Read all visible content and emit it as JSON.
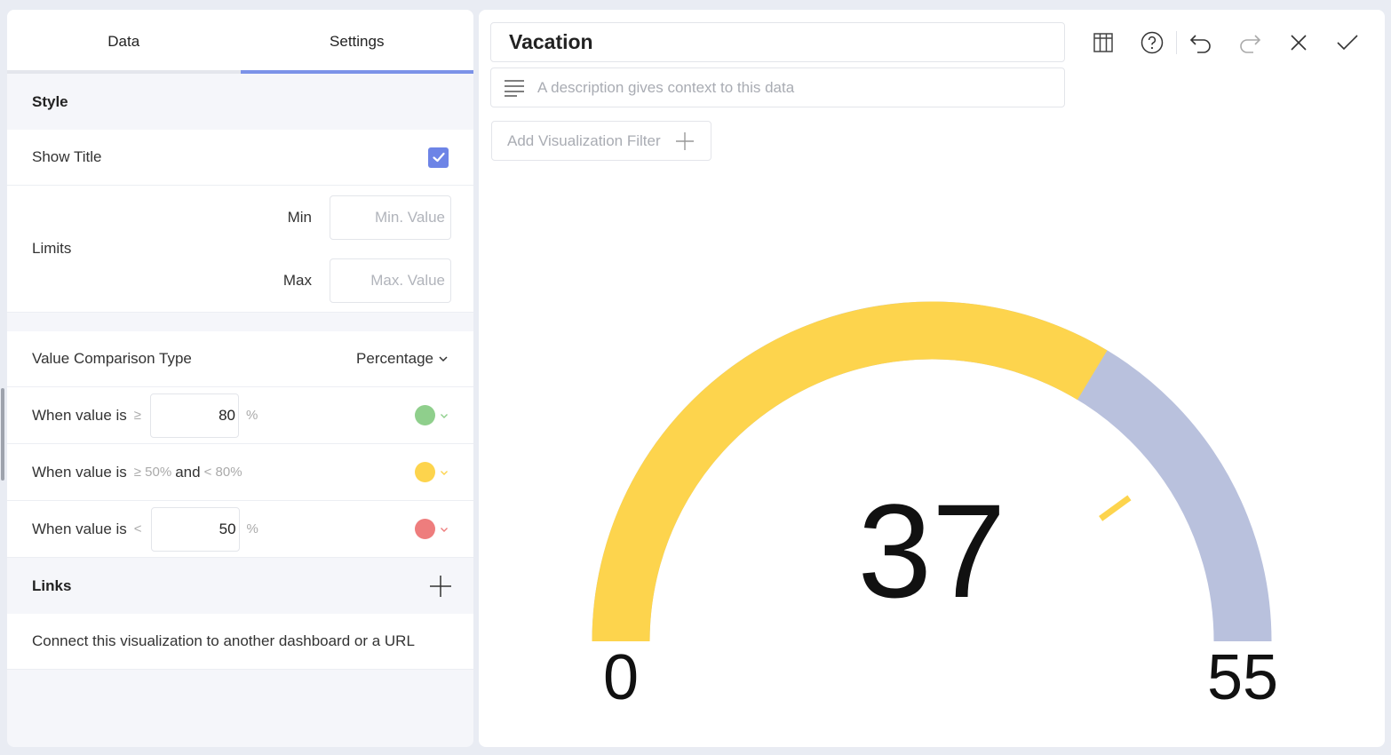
{
  "tabs": {
    "data": "Data",
    "settings": "Settings"
  },
  "style": {
    "heading": "Style",
    "show_title_label": "Show Title",
    "show_title_checked": true,
    "limits_label": "Limits",
    "min_label": "Min",
    "min_placeholder": "Min. Value",
    "max_label": "Max",
    "max_placeholder": "Max. Value"
  },
  "comparison": {
    "label": "Value Comparison Type",
    "value": "Percentage",
    "rules": [
      {
        "label": "When value is",
        "op": "≥",
        "value": "80",
        "unit": "%",
        "color": "#8fcf8c"
      },
      {
        "label": "When value is",
        "op_low": "≥ 50%",
        "and": "and",
        "op_high": "< 80%",
        "color": "#fdd44d"
      },
      {
        "label": "When value is",
        "op": "<",
        "value": "50",
        "unit": "%",
        "color": "#ee7d7d"
      }
    ]
  },
  "links": {
    "heading": "Links",
    "description": "Connect this visualization to another dashboard or a URL"
  },
  "editor": {
    "title": "Vacation",
    "description_placeholder": "A description gives context to this data",
    "filter_label": "Add Visualization Filter"
  },
  "toolbar": [
    "table-icon",
    "help-icon",
    "undo-icon",
    "redo-icon",
    "close-icon",
    "check-icon"
  ],
  "gauge": {
    "value": 37,
    "value_label": "37",
    "min": 0,
    "max": 55,
    "min_label": "0",
    "max_label": "55",
    "target_pct": 80,
    "fill_color": "#fdd44d",
    "track_color": "#b9c1dd"
  }
}
